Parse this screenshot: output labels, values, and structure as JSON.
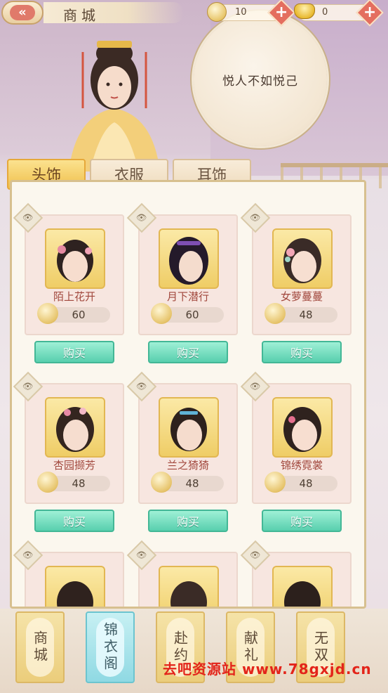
{
  "header": {
    "title": "商城",
    "coins": "10",
    "ingots": "0"
  },
  "banner": {
    "quote": "悦人不如悦己"
  },
  "tabs": [
    {
      "label": "头饰",
      "active": true
    },
    {
      "label": "衣服",
      "active": false
    },
    {
      "label": "耳饰",
      "active": false
    }
  ],
  "items": [
    {
      "name": "陌上花开",
      "price": "60",
      "buy": "购买"
    },
    {
      "name": "月下潜行",
      "price": "60",
      "buy": "购买"
    },
    {
      "name": "女萝蔓蔓",
      "price": "48",
      "buy": "购买"
    },
    {
      "name": "杏园撷芳",
      "price": "48",
      "buy": "购买"
    },
    {
      "name": "兰之猗猗",
      "price": "48",
      "buy": "购买"
    },
    {
      "name": "锦绣霓裳",
      "price": "48",
      "buy": "购买"
    }
  ],
  "nav": [
    {
      "label": "商城",
      "active": false
    },
    {
      "label": "锦衣阁",
      "active": true
    },
    {
      "label": "赴约",
      "active": false
    },
    {
      "label": "献礼",
      "active": false
    },
    {
      "label": "无双",
      "active": false
    }
  ],
  "watermark": "去吧资源站 www.78gxjd.cn",
  "colors": {
    "accent": "#f0c04d",
    "buy": "#58cfae",
    "price_text": "#a1473c"
  }
}
